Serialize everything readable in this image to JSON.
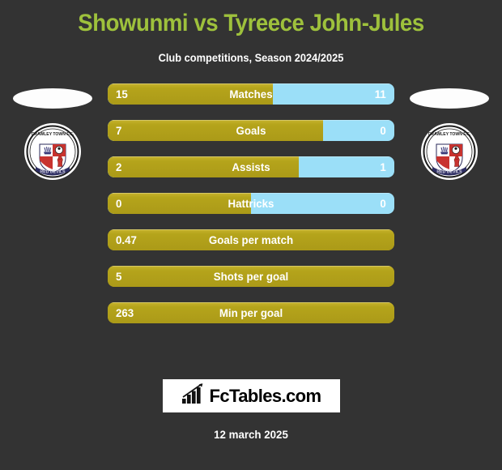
{
  "header": {
    "title": "Showunmi vs Tyreece John-Jules",
    "subtitle": "Club competitions, Season 2024/2025",
    "title_color": "#9ec13c",
    "subtitle_color": "#ffffff"
  },
  "theme": {
    "background": "#333333",
    "home_color": "#b5a41b",
    "away_color": "#9bdff8",
    "text_color": "#ffffff"
  },
  "teams": {
    "left": {
      "badge_name": "crawley-town-fc-badge",
      "badge_title": "CRAWLEY TOWN F.C.",
      "badge_motto": "RED DEVILS"
    },
    "right": {
      "badge_name": "crawley-town-fc-badge",
      "badge_title": "CRAWLEY TOWN F.C.",
      "badge_motto": "RED DEVILS"
    }
  },
  "chart_data": {
    "type": "bar",
    "title": "Showunmi vs Tyreece John-Jules",
    "subtitle": "Club competitions, Season 2024/2025",
    "orientation": "horizontal-diverging",
    "legend_position": "none",
    "grid": false,
    "series": [
      {
        "name": "Showunmi",
        "color": "#b5a41b",
        "values": [
          15,
          7,
          2,
          0,
          0.47,
          5,
          263
        ]
      },
      {
        "name": "Tyreece John-Jules",
        "color": "#9bdff8",
        "values": [
          11,
          0,
          1,
          0,
          null,
          null,
          null
        ]
      }
    ],
    "categories": [
      "Matches",
      "Goals",
      "Assists",
      "Hattricks",
      "Goals per match",
      "Shots per goal",
      "Min per goal"
    ],
    "rows": [
      {
        "label": "Matches",
        "left": "15",
        "right": "11",
        "left_pct": 57.7,
        "single": false
      },
      {
        "label": "Goals",
        "left": "7",
        "right": "0",
        "left_pct": 75.0,
        "single": false
      },
      {
        "label": "Assists",
        "left": "2",
        "right": "1",
        "left_pct": 66.7,
        "single": false
      },
      {
        "label": "Hattricks",
        "left": "0",
        "right": "0",
        "left_pct": 50.0,
        "single": false
      },
      {
        "label": "Goals per match",
        "left": "0.47",
        "right": "",
        "left_pct": 100,
        "single": true
      },
      {
        "label": "Shots per goal",
        "left": "5",
        "right": "",
        "left_pct": 100,
        "single": true
      },
      {
        "label": "Min per goal",
        "left": "263",
        "right": "",
        "left_pct": 100,
        "single": true
      }
    ]
  },
  "footer": {
    "brand": "FcTables.com",
    "logo_icon": "bar-chart-growth-icon",
    "date": "12 march 2025"
  }
}
